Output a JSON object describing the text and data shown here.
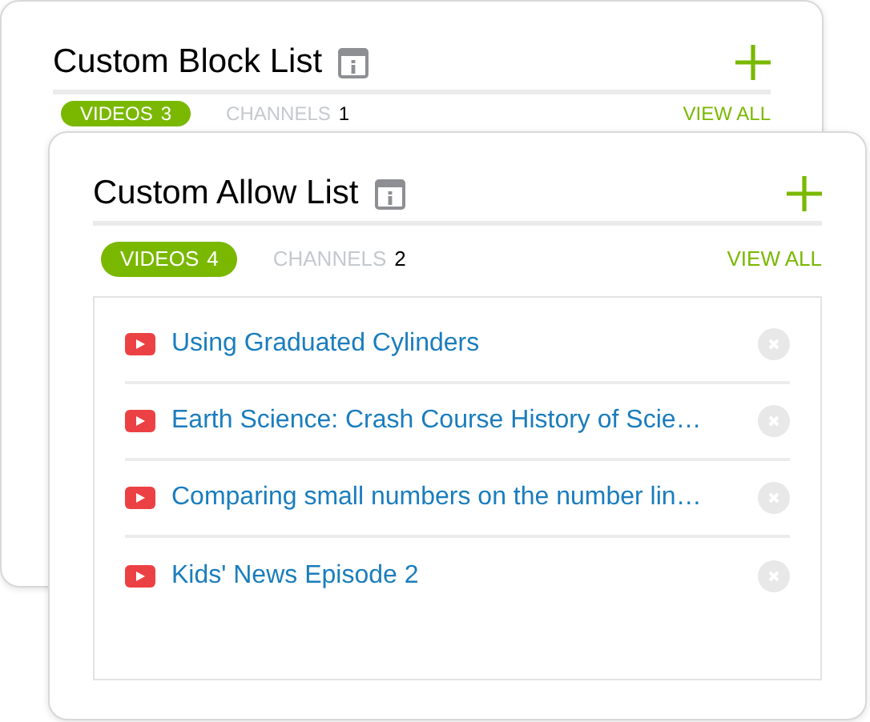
{
  "cards": [
    {
      "title": "Custom Block List",
      "tabs": [
        {
          "label": "VIDEOS",
          "count": "3",
          "selected": true
        },
        {
          "label": "CHANNELS",
          "count": "1",
          "selected": false
        }
      ],
      "view_all": "VIEW ALL"
    },
    {
      "title": "Custom Allow List",
      "tabs": [
        {
          "label": "VIDEOS",
          "count": "4",
          "selected": true
        },
        {
          "label": "CHANNELS",
          "count": "2",
          "selected": false
        }
      ],
      "view_all": "VIEW ALL",
      "items": [
        {
          "title": "Using Graduated Cylinders"
        },
        {
          "title": "Earth Science: Crash Course History of Scie…"
        },
        {
          "title": "Comparing small numbers on the number lin…"
        },
        {
          "title": "Kids' News Episode 2"
        }
      ]
    }
  ]
}
